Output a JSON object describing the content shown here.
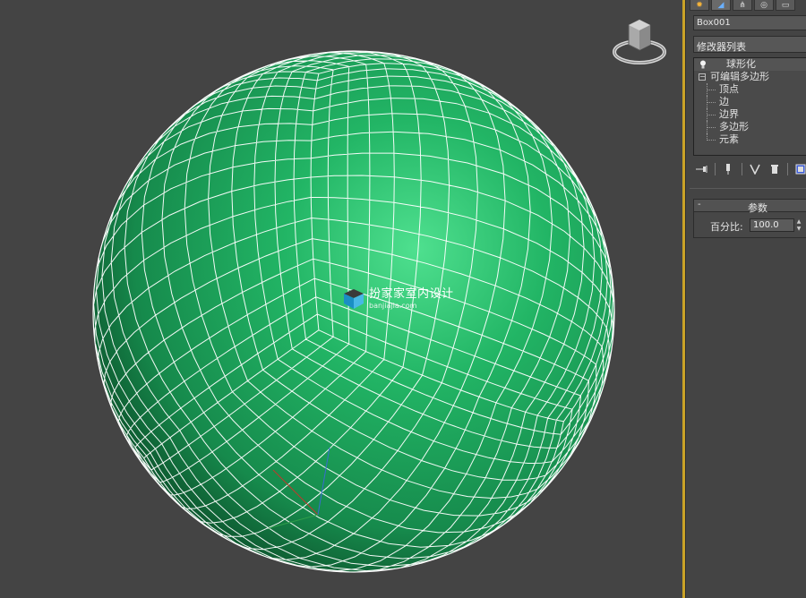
{
  "viewport": {
    "watermark_title": "扮家家室内设计",
    "watermark_sub": "banjiajia.com",
    "mesh_color": "#1f9e5a",
    "wire_color": "#ffffff",
    "background": "#444444",
    "active_border": "#c9a227"
  },
  "command_panel": {
    "tabs": [
      "create-icon",
      "modify-icon",
      "hierarchy-icon",
      "motion-icon",
      "display-icon"
    ],
    "object_name": "Box001",
    "modifier_list_label": "修改器列表",
    "stack": {
      "top_modifier": "球形化",
      "base_object": "可编辑多边形",
      "sub_objects": [
        "顶点",
        "边",
        "边界",
        "多边形",
        "元素"
      ]
    },
    "parameters": {
      "rollout_toggle": "-",
      "title": "参数",
      "percent_label": "百分比:",
      "percent_value": "100.0"
    }
  }
}
